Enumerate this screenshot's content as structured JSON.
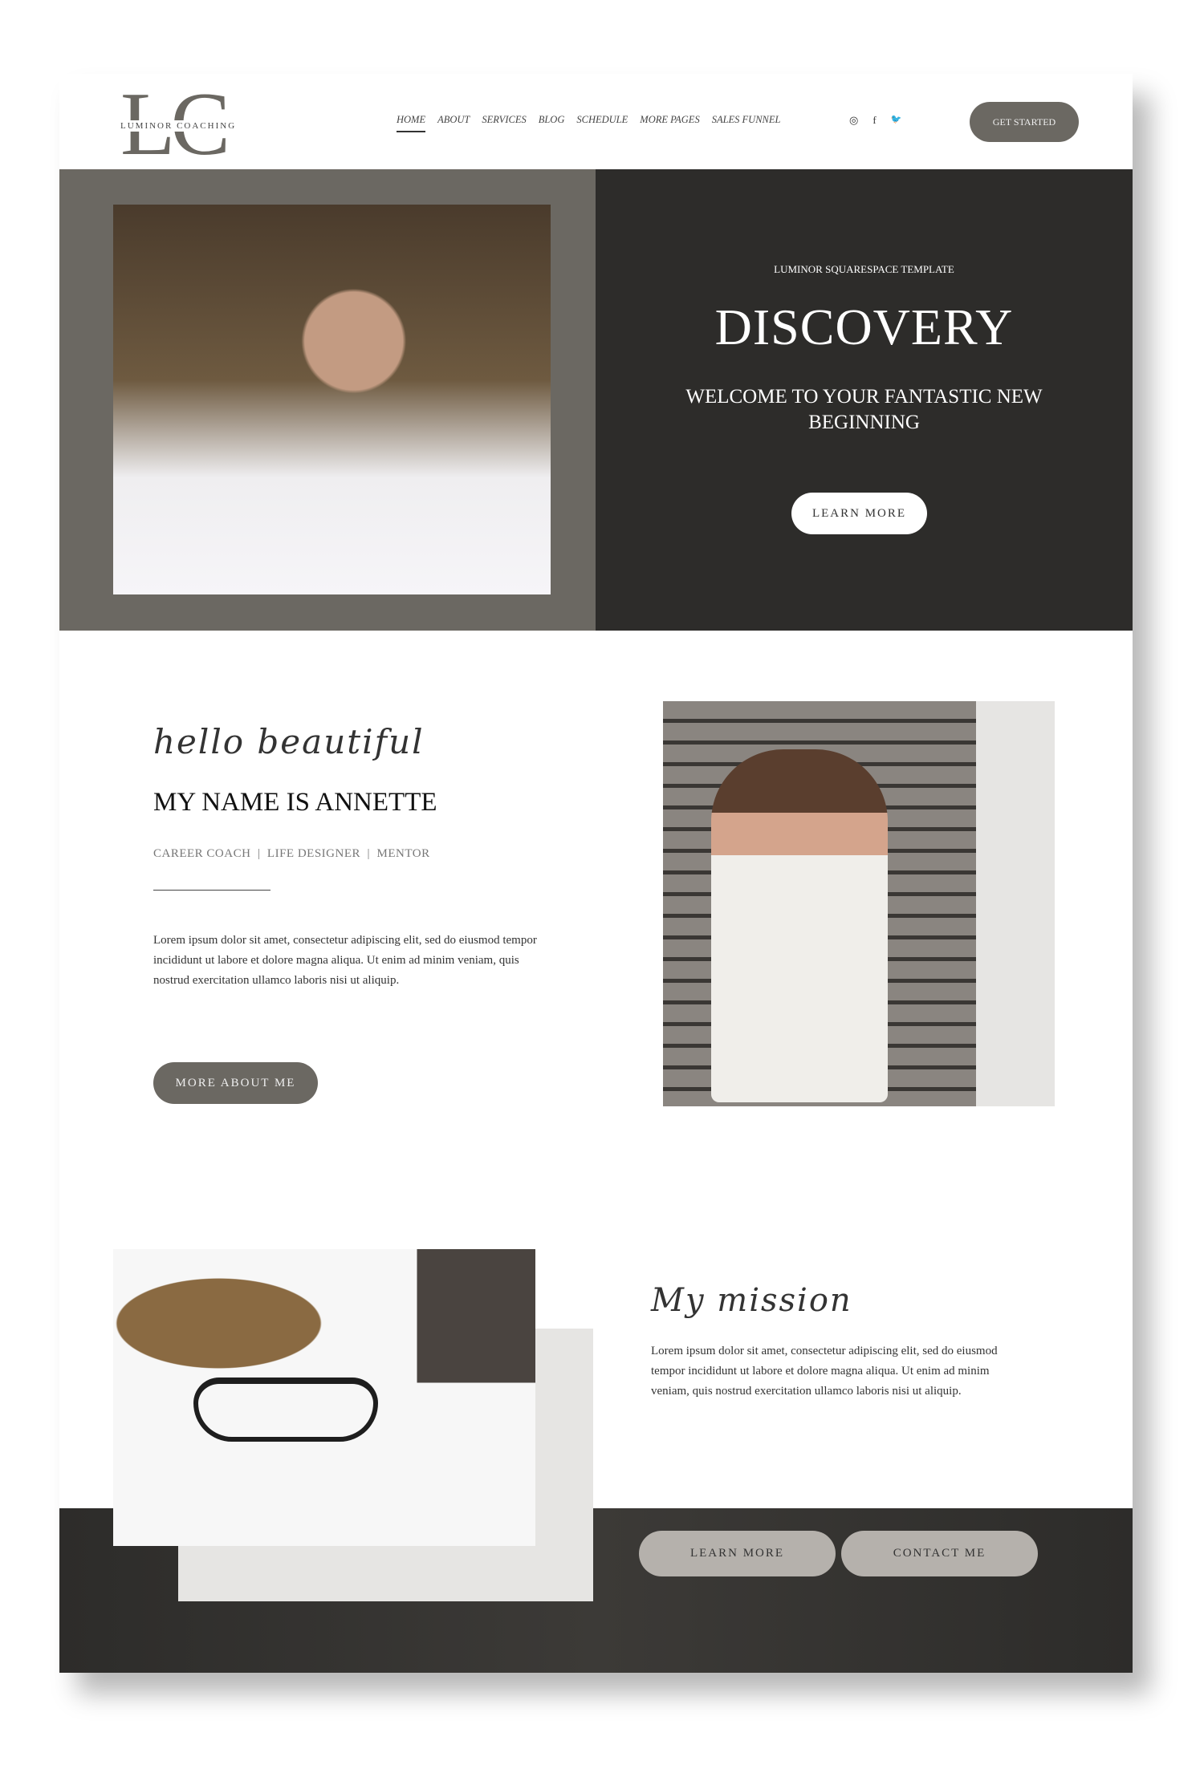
{
  "brand": {
    "logo_letters": "LC",
    "logo_text": "LUMINOR COACHING"
  },
  "nav": {
    "items": [
      "HOME",
      "ABOUT",
      "SERVICES",
      "BLOG",
      "SCHEDULE",
      "MORE PAGES",
      "SALES FUNNEL"
    ],
    "active": "HOME"
  },
  "social": {
    "icons": [
      "instagram-icon",
      "facebook-icon",
      "twitter-icon"
    ],
    "glyphs": [
      "◎",
      "f",
      "🐦"
    ]
  },
  "header": {
    "cta": "GET STARTED"
  },
  "hero": {
    "eyebrow": "LUMINOR SQUARESPACE TEMPLATE",
    "title": "DISCOVERY",
    "subtitle": "WELCOME TO YOUR FANTASTIC NEW BEGINNING",
    "button": "LEARN MORE"
  },
  "about": {
    "script": "hello beautiful",
    "heading": "MY NAME IS ANNETTE",
    "roles": "CAREER COACH  |  LIFE DESIGNER  |  MENTOR",
    "body": "Lorem ipsum dolor sit amet, consectetur adipiscing elit, sed do eiusmod tempor incididunt ut labore et dolore magna aliqua. Ut enim ad minim veniam, quis nostrud exercitation ullamco laboris nisi ut aliquip.",
    "button": "MORE ABOUT ME"
  },
  "mission": {
    "script": "My mission",
    "body": "Lorem ipsum dolor sit amet, consectetur adipiscing elit, sed do eiusmod tempor incididunt ut labore et dolore magna aliqua. Ut enim ad minim veniam, quis nostrud exercitation ullamco laboris nisi ut aliquip.",
    "buttons": [
      "LEARN MORE",
      "CONTACT ME"
    ]
  },
  "colors": {
    "taupe": "#6b6862",
    "dark": "#2d2c2a",
    "light_grey": "#e6e5e3",
    "button_grey": "#b5b1ac"
  }
}
